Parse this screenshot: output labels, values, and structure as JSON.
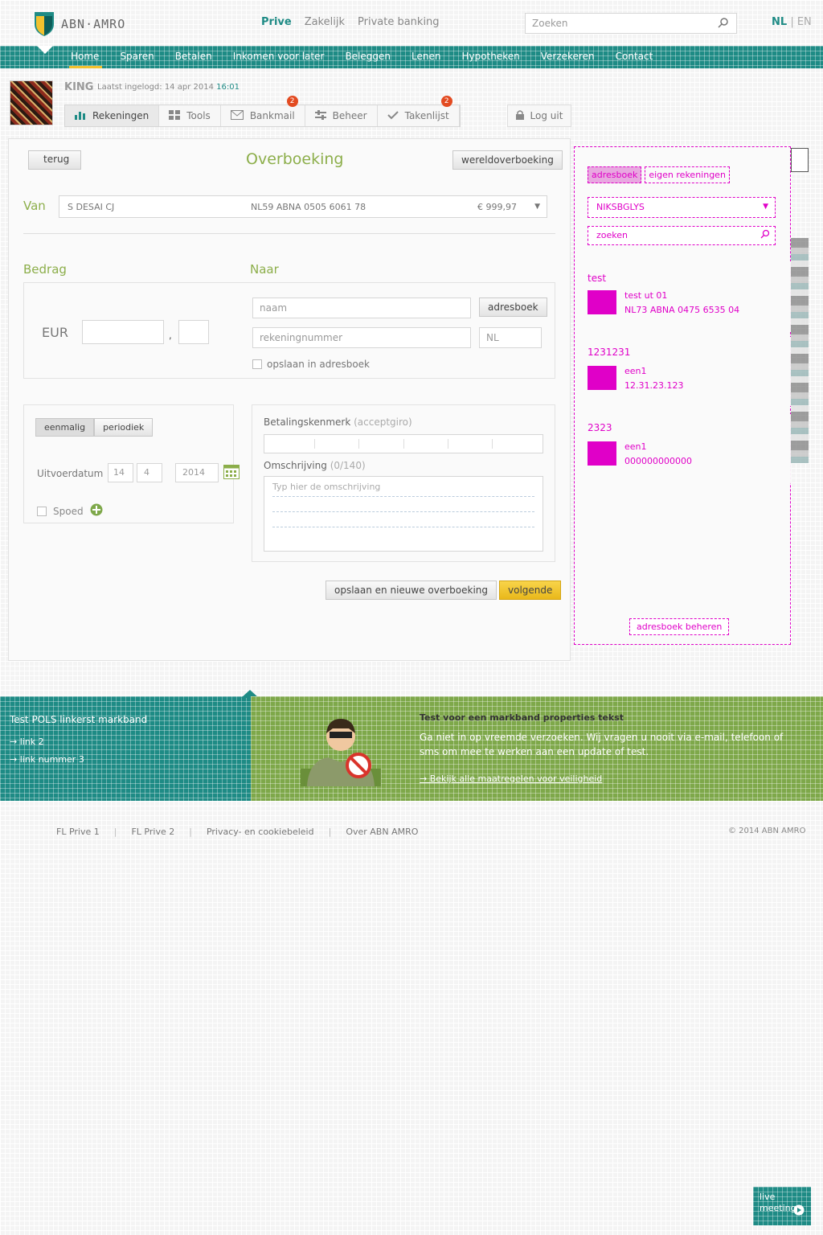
{
  "brand": {
    "name": "ABN·AMRO"
  },
  "topnav": {
    "items": [
      "Prive",
      "Zakelijk",
      "Private banking"
    ],
    "active": "Prive"
  },
  "search": {
    "placeholder": "Zoeken"
  },
  "lang": {
    "nl": "NL",
    "sep": "|",
    "en": "EN"
  },
  "mainnav": {
    "items": [
      "Home",
      "Sparen",
      "Betalen",
      "Inkomen voor later",
      "Beleggen",
      "Lenen",
      "Hypotheken",
      "Verzekeren",
      "Contact"
    ]
  },
  "user": {
    "name": "KING",
    "last_login_label": "Laatst ingelogd: 14 apr 2014",
    "last_login_time": "16:01"
  },
  "tabs": [
    {
      "label": "Rekeningen",
      "icon": "bar-chart-icon",
      "badge": ""
    },
    {
      "label": "Tools",
      "icon": "grid-icon",
      "badge": ""
    },
    {
      "label": "Bankmail",
      "icon": "mail-icon",
      "badge": "2"
    },
    {
      "label": "Beheer",
      "icon": "settings-icon",
      "badge": ""
    },
    {
      "label": "Takenlijst",
      "icon": "check-icon",
      "badge": "2"
    }
  ],
  "logout": {
    "label": "Log uit"
  },
  "form": {
    "back": "terug",
    "title": "Overboeking",
    "intl": "wereldoverboeking",
    "van_label": "Van",
    "van_name": "S DESAI CJ",
    "van_iban": "NL59 ABNA 0505 6061 78",
    "van_balance": "€ 999,97",
    "bedrag_label": "Bedrag",
    "naar_label": "Naar",
    "currency": "EUR",
    "comma": ",",
    "naam_placeholder": "naam",
    "adresboek": "adresboek",
    "rek_placeholder": "rekeningnummer",
    "country": "NL",
    "save_addr": "opslaan in adresboek",
    "freq": [
      "eenmalig",
      "periodiek"
    ],
    "uitv_label": "Uitvoerdatum",
    "date_day": "14",
    "date_month": "4",
    "date_year": "2014",
    "spoed": "Spoed",
    "betk_label": "Betalingskenmerk",
    "betk_sub": "(acceptgiro)",
    "oms_label": "Omschrijving",
    "oms_sub": "(0/140)",
    "oms_placeholder": "Typ hier de omschrijving",
    "save_new": "opslaan en nieuwe overboeking",
    "next": "volgende"
  },
  "addressbook": {
    "tabs": [
      "adresboek",
      "eigen rekeningen"
    ],
    "select": "NIKSBGLYS",
    "search_placeholder": "zoeken",
    "groups": [
      {
        "title": "test",
        "line1": "test ut 01",
        "line2": "NL73 ABNA 0475 6535 04"
      },
      {
        "title": "1231231",
        "line1": "een1",
        "line2": "12.31.23.123"
      },
      {
        "title": "2323",
        "line1": "een1",
        "line2": "000000000000"
      }
    ],
    "manage": "adresboek beheren"
  },
  "promo": {
    "left_title": "Test POLS linkerst markband",
    "left_links": [
      "→ link 2",
      "→ link nummer 3"
    ],
    "right_title": "Test voor een markband properties tekst",
    "right_body": "Ga niet in op vreemde verzoeken. Wij vragen u nooit via e-mail, telefoon of sms om mee te werken aan een update of test.",
    "right_link": "→ Bekijk alle maatregelen voor veiligheid"
  },
  "footer": {
    "links": [
      "FL Prive 1",
      "FL Prive 2",
      "Privacy- en cookiebeleid",
      "Over ABN AMRO"
    ],
    "copyright": "© 2014 ABN AMRO"
  },
  "help": {
    "label": "live meeting"
  },
  "colors": {
    "teal": "#1e8b85",
    "green": "#7ea84a",
    "accent_yellow": "#f2c12e",
    "magenta": "#e000c8",
    "badge": "#e34b21"
  }
}
